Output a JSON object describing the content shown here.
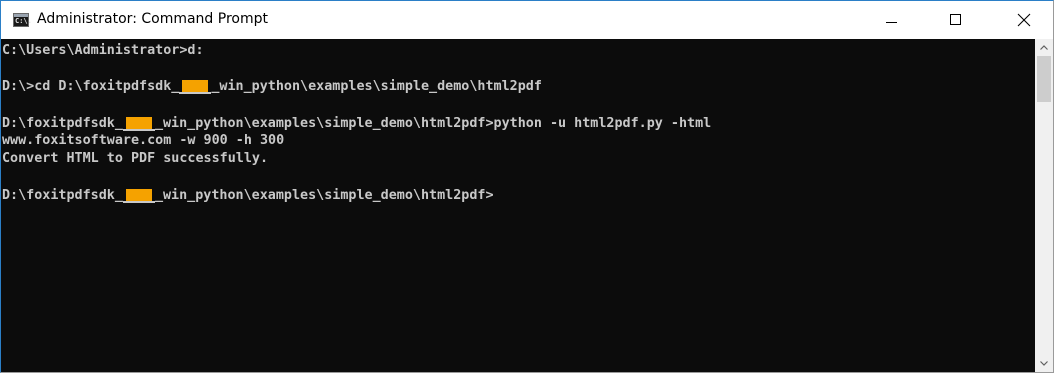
{
  "window": {
    "title": "Administrator: Command Prompt",
    "icon": "cmd-console-icon",
    "icon_glyph": "C:\\."
  },
  "controls": {
    "minimize_icon": "minimize-icon",
    "maximize_icon": "maximize-icon",
    "close_icon": "close-icon"
  },
  "console": {
    "background": "#0c0c0c",
    "foreground": "#c8c8c8",
    "redaction_color": "#f5a200",
    "lines": [
      {
        "text": "C:\\Users\\Administrator>d:"
      },
      {
        "text": ""
      },
      {
        "pre": "D:\\>cd D:\\foxitpdfsdk_",
        "post": "_win_python\\examples\\simple_demo\\html2pdf"
      },
      {
        "text": ""
      },
      {
        "pre": "D:\\foxitpdfsdk_",
        "post": "_win_python\\examples\\simple_demo\\html2pdf>python -u html2pdf.py -html"
      },
      {
        "text": "www.foxitsoftware.com -w 900 -h 300"
      },
      {
        "text": "Convert HTML to PDF successfully."
      },
      {
        "text": ""
      },
      {
        "pre": "D:\\foxitpdfsdk_",
        "post": "_win_python\\examples\\simple_demo\\html2pdf>"
      }
    ]
  },
  "scrollbar": {
    "up_icon": "scroll-up-arrow-icon",
    "down_icon": "scroll-down-arrow-icon"
  }
}
